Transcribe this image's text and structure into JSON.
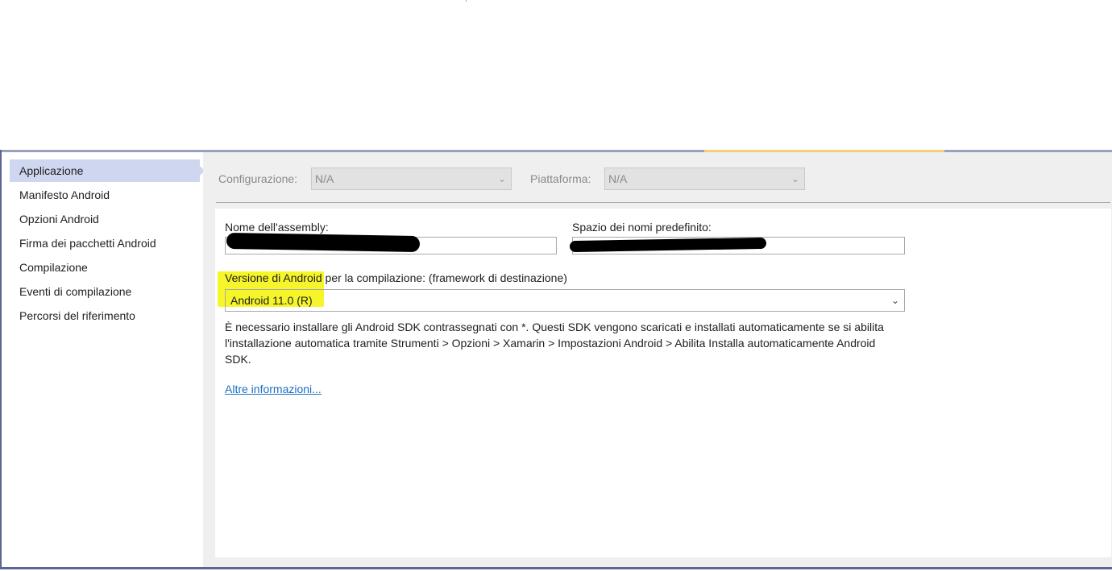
{
  "sidebar": {
    "items": [
      {
        "label": "Applicazione",
        "selected": true
      },
      {
        "label": "Manifesto Android"
      },
      {
        "label": "Opzioni Android"
      },
      {
        "label": "Firma dei pacchetti Android"
      },
      {
        "label": "Compilazione"
      },
      {
        "label": "Eventi di compilazione"
      },
      {
        "label": "Percorsi del riferimento"
      }
    ]
  },
  "config": {
    "configuration_label": "Configurazione:",
    "configuration_value": "N/A",
    "platform_label": "Piattaforma:",
    "platform_value": "N/A"
  },
  "form": {
    "assembly_label": "Nome dell'assembly:",
    "namespace_label": "Spazio dei nomi predefinito:",
    "target_label": "Versione di Android per la compilazione: (framework di destinazione)",
    "target_value": "Android 11.0 (R)",
    "info": "È necessario installare gli Android SDK contrassegnati con *. Questi SDK vengono scaricati e installati automaticamente se si abilita l'installazione automatica tramite Strumenti > Opzioni > Xamarin > Impostazioni Android > Abilita Installa automaticamente Android SDK.",
    "more_info_link": "Altre informazioni..."
  },
  "colors": {
    "accent_selected": "#cfd6ef",
    "highlight": "#f6f52a",
    "link": "#1a6ec0",
    "frame_border": "#5b6596"
  }
}
